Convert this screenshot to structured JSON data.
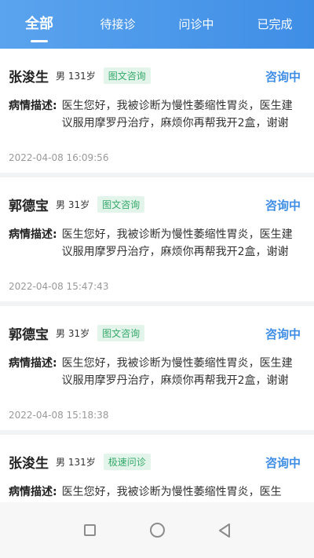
{
  "tabs": [
    {
      "label": "全部",
      "active": true
    },
    {
      "label": "待接诊",
      "active": false
    },
    {
      "label": "问诊中",
      "active": false
    },
    {
      "label": "已完成",
      "active": false
    }
  ],
  "colors": {
    "accent": "#3f8ee6",
    "tag_text": "#35a86b",
    "tag_bg": "#e3f5ea",
    "page_bg": "#f2f3f5"
  },
  "consultations": [
    {
      "name": "张浚生",
      "gender_age": "男 131岁",
      "tag": "图文咨询",
      "status": "咨询中",
      "desc_label": "病情描述:",
      "desc_text": "医生您好，我被诊断为慢性萎缩性胃炎，医生建议服用摩罗丹治疗，麻烦你再帮我开2盒，谢谢",
      "time": "2022-04-08 16:09:56"
    },
    {
      "name": "郭德宝",
      "gender_age": "男 31岁",
      "tag": "图文咨询",
      "status": "咨询中",
      "desc_label": "病情描述:",
      "desc_text": "医生您好，我被诊断为慢性萎缩性胃炎，医生建议服用摩罗丹治疗，麻烦你再帮我开2盒，谢谢",
      "time": "2022-04-08 15:47:43"
    },
    {
      "name": "郭德宝",
      "gender_age": "男 31岁",
      "tag": "图文咨询",
      "status": "咨询中",
      "desc_label": "病情描述:",
      "desc_text": "医生您好，我被诊断为慢性萎缩性胃炎，医生建议服用摩罗丹治疗，麻烦你再帮我开2盒，谢谢",
      "time": "2022-04-08 15:18:38"
    },
    {
      "name": "张浚生",
      "gender_age": "男 131岁",
      "tag": "极速问诊",
      "status": "咨询中",
      "desc_label": "病情描述:",
      "desc_text": "医生您好，我被诊断为慢性萎缩性胃炎，医生",
      "time": ""
    }
  ],
  "system_nav": {
    "icons": [
      "recent-apps-icon",
      "home-icon",
      "back-icon"
    ]
  }
}
